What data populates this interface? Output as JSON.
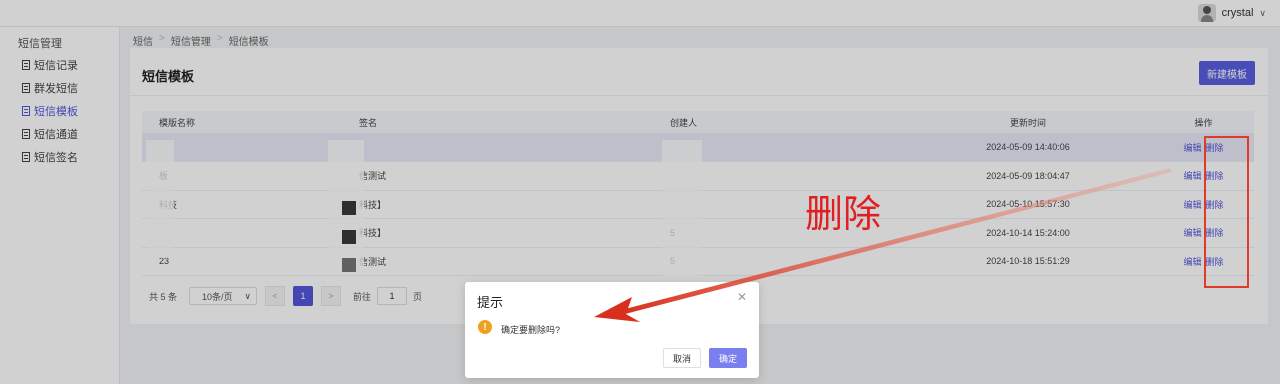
{
  "topbar": {
    "username": "crystal",
    "dropdown_icon": "chevron-down-icon"
  },
  "sidebar": {
    "title": "短信管理",
    "items": [
      {
        "label": "短信记录",
        "active": false
      },
      {
        "label": "群发短信",
        "active": false
      },
      {
        "label": "短信模板",
        "active": true
      },
      {
        "label": "短信通道",
        "active": false
      },
      {
        "label": "短信签名",
        "active": false
      }
    ]
  },
  "breadcrumb": [
    "短信",
    "短信管理",
    "短信模板"
  ],
  "main": {
    "title": "短信模板",
    "new_button": "新建模板",
    "columns": [
      "模版名称",
      "签名",
      "创建人",
      "更新时间",
      "操作"
    ],
    "rows": [
      {
        "name": "",
        "sign": "",
        "creator": "",
        "time": "2024-05-09 14:40:06",
        "edit": "编辑",
        "delete": "删除"
      },
      {
        "name": "板",
        "sign": "信测试",
        "creator": "",
        "time": "2024-05-09 18:04:47",
        "edit": "编辑",
        "delete": "删除"
      },
      {
        "name": "科技",
        "sign": "科技】",
        "creator": "",
        "time": "2024-05-10 15:57:30",
        "edit": "编辑",
        "delete": "删除"
      },
      {
        "name": "",
        "sign": "科技】",
        "creator": "5",
        "time": "2024-10-14 15:24:00",
        "edit": "编辑",
        "delete": "删除"
      },
      {
        "name": "23",
        "sign": "信测试",
        "creator": "5",
        "time": "2024-10-18 15:51:29",
        "edit": "编辑",
        "delete": "删除"
      }
    ],
    "pagination": {
      "total": "共 5 条",
      "page_size": "10条/页",
      "current": "1",
      "goto_label": "前往",
      "goto_value": "1",
      "goto_suffix": "页"
    }
  },
  "dialog": {
    "title": "提示",
    "message": "确定要删除吗?",
    "cancel": "取消",
    "confirm": "确定"
  },
  "annotation": {
    "text": "删除",
    "color": "#e02020"
  },
  "colors": {
    "accent": "#5356d9",
    "warning": "#f0a020",
    "annotation": "#e03a2a"
  }
}
